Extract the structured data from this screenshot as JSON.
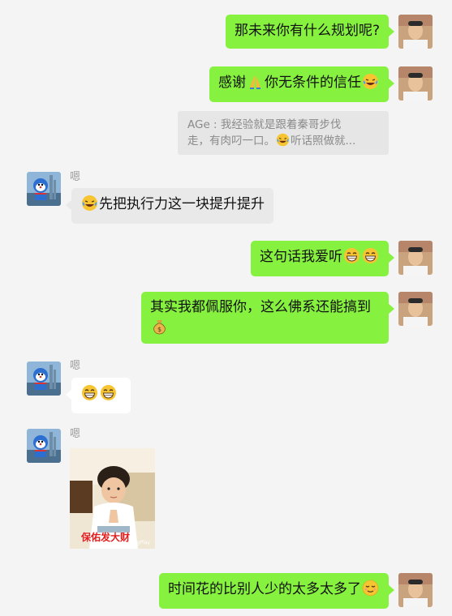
{
  "messages": {
    "m1": {
      "text": "那未来你有什么规划呢?"
    },
    "m2": {
      "text_a": "感谢",
      "text_b": "你无条件的信任",
      "emojis": [
        "folded-hands-emoji",
        "laughing-tears-emoji"
      ]
    },
    "m2_quote": {
      "text_a": "AGe : 我经验就是跟着秦哥步伐",
      "text_b": "走，有肉叼一口。",
      "text_c": "听话照做就..."
    },
    "m3": {
      "sender": "嗯",
      "text": "先把执行力这一块提升提升",
      "emojis": [
        "laughing-tears-emoji"
      ]
    },
    "m4": {
      "text": "这句话我爱听",
      "emojis": [
        "grinning-emoji",
        "grinning-emoji"
      ]
    },
    "m5": {
      "text": "其实我都佩服你，这么佛系还能搞到",
      "emojis": [
        "money-bag-emoji"
      ]
    },
    "m6": {
      "sender": "嗯",
      "emojis": [
        "grinning-emoji",
        "grinning-emoji"
      ]
    },
    "m7": {
      "sender": "嗯",
      "sticker_caption": "保佑发大财",
      "sticker_watermark": "ImgPlay"
    },
    "m8": {
      "text": "时间花的比别人少的太多太多了",
      "emojis": [
        "relieved-emoji"
      ]
    }
  },
  "colors": {
    "my_bubble": "#86f23f",
    "other_bubble": "#e9e9e9",
    "background": "#f4f4f4"
  }
}
